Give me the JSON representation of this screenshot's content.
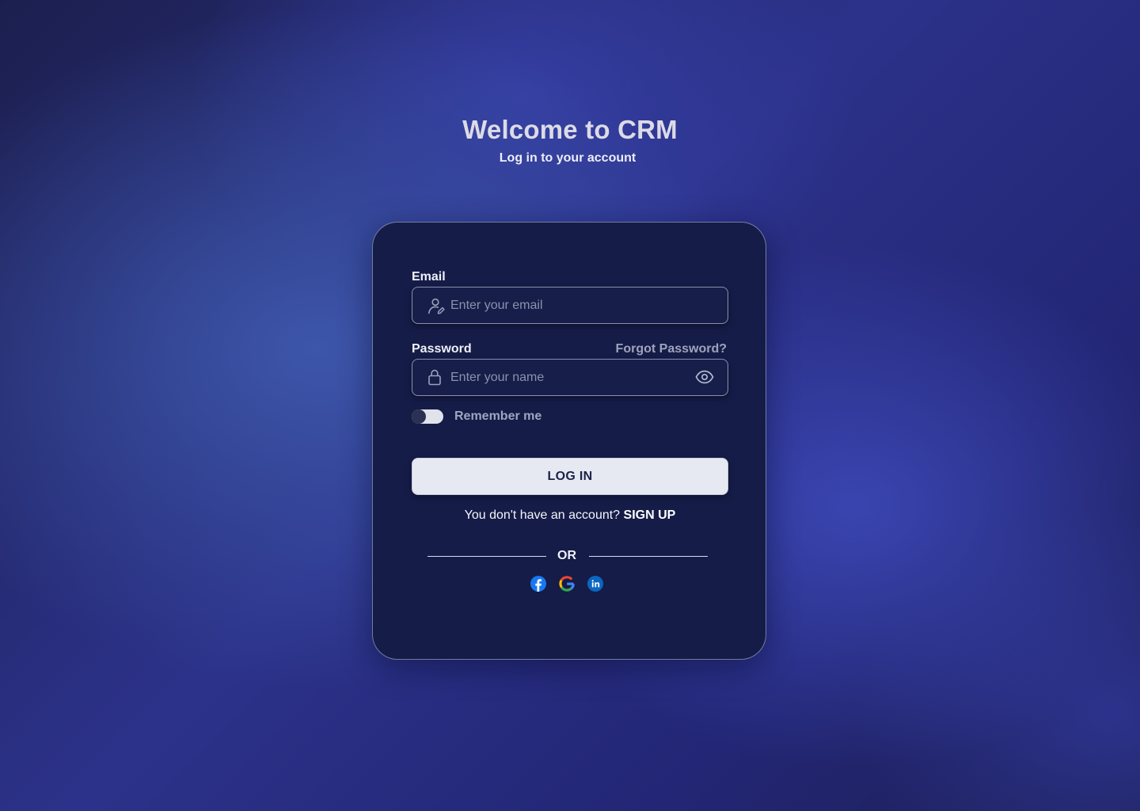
{
  "header": {
    "title": "Welcome to CRM",
    "subtitle": "Log in to your account"
  },
  "form": {
    "email": {
      "label": "Email",
      "placeholder": "Enter your email",
      "value": "",
      "icon": "user-edit-icon"
    },
    "password": {
      "label": "Password",
      "placeholder": "Enter your name",
      "value": "",
      "icon": "lock-icon",
      "toggle_icon": "eye-icon"
    },
    "forgot_password": "Forgot Password?",
    "remember_me": {
      "label": "Remember me",
      "checked": false
    },
    "login_button": "LOG IN",
    "signup_prompt": "You don't have an account?",
    "signup_link": "SIGN UP",
    "divider": "OR",
    "social": [
      {
        "name": "facebook-icon",
        "color": "#1877F2"
      },
      {
        "name": "google-icon",
        "color": "#4285F4"
      },
      {
        "name": "linkedin-icon",
        "color": "#0A66C2"
      }
    ]
  },
  "colors": {
    "card_background": "#151c47",
    "button_background": "#e6e9f2",
    "button_text": "#1c2148"
  }
}
